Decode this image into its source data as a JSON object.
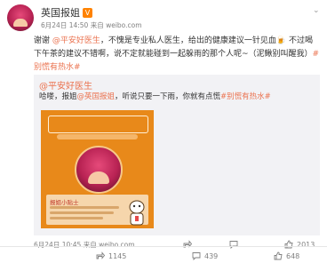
{
  "post": {
    "author": "英国报姐",
    "verified": "V",
    "meta": "6月24日 14:50 来自 weibo.com",
    "text": [
      {
        "t": "谢谢 ",
        "c": "normal"
      },
      {
        "t": "@平安好医生",
        "c": "link"
      },
      {
        "t": "，不愧是专业私人医生，给出的健康建议一针见血🍺 不过喝下午茶的建议不错啊，说不定就能碰到一起躲雨的那个人呢~（泥鳅别叫醒我）",
        "c": "normal"
      },
      {
        "t": "#别慌有热水#",
        "c": "tag"
      }
    ]
  },
  "repost": {
    "author": "@平安好医生",
    "text_parts": [
      {
        "t": "哈喽，报姐",
        "c": "normal"
      },
      {
        "t": "@英国报姐",
        "c": "link"
      },
      {
        "t": "，听说只要一下雨，你就有点慌",
        "c": "normal"
      },
      {
        "t": "#别慌有热水#",
        "c": "tag"
      }
    ],
    "footer_meta": "6月24日 10:45 来自 weibo.com",
    "shot_card_title": "报姐小贴士"
  },
  "repost_actions": {
    "share": "",
    "comment": "",
    "like": "2013"
  },
  "bottom_actions": {
    "share": "1145",
    "comment": "439",
    "like": "648"
  },
  "icons": {
    "chevron": "chevron-down-icon",
    "share": "share-icon",
    "comment": "comment-icon",
    "like": "like-icon"
  },
  "colors": {
    "link": "#eb7350",
    "repost_bg": "#f2f2f5",
    "vip": "#ff8200"
  }
}
